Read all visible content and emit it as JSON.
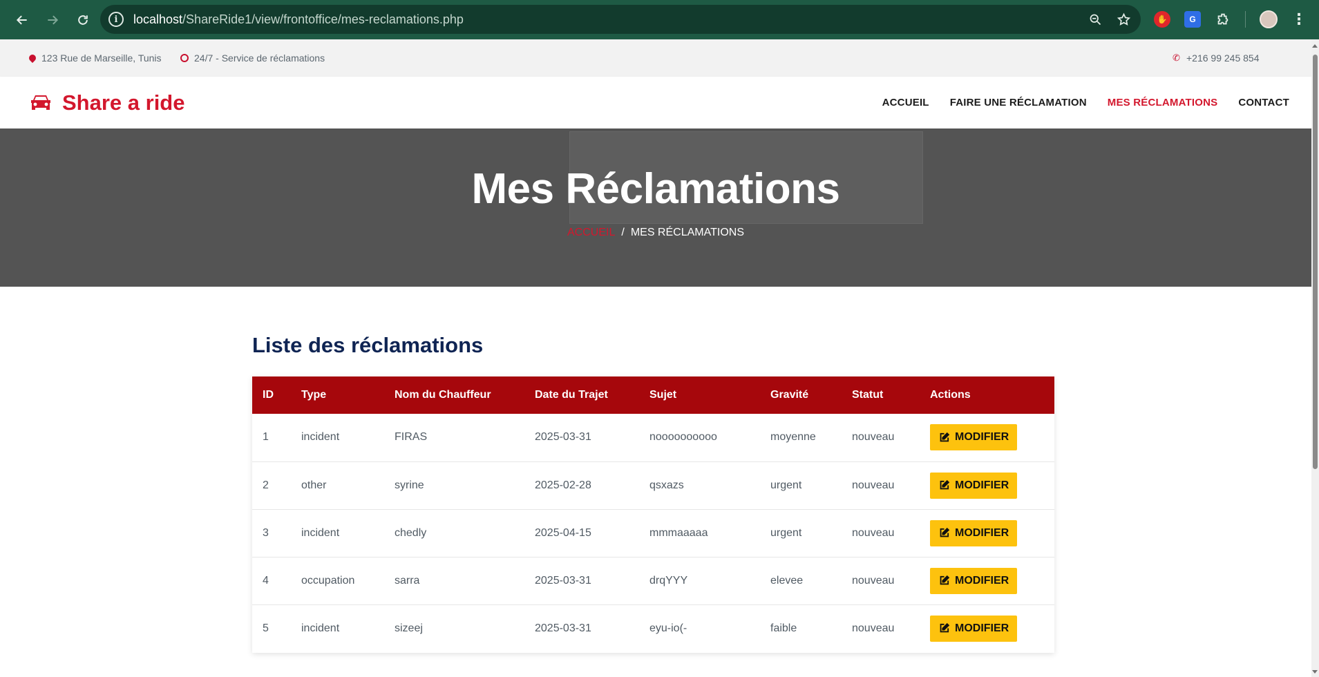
{
  "browser": {
    "url_host": "localhost",
    "url_path": "/ShareRide1/view/frontoffice/mes-reclamations.php"
  },
  "topbar": {
    "address": "123 Rue de Marseille, Tunis",
    "service": "24/7 - Service de réclamations",
    "phone": "+216 99 245 854"
  },
  "nav": {
    "brand": "Share a ride",
    "items": [
      {
        "label": "ACCUEIL"
      },
      {
        "label": "FAIRE UNE RÉCLAMATION"
      },
      {
        "label": "MES RÉCLAMATIONS"
      },
      {
        "label": "CONTACT"
      }
    ]
  },
  "hero": {
    "title": "Mes Réclamations",
    "crumb_home": "ACCUEIL",
    "crumb_sep": "/",
    "crumb_current": "MES RÉCLAMATIONS"
  },
  "section": {
    "title": "Liste des réclamations"
  },
  "table": {
    "headers": [
      "ID",
      "Type",
      "Nom du Chauffeur",
      "Date du Trajet",
      "Sujet",
      "Gravité",
      "Statut",
      "Actions"
    ],
    "action_label": "MODIFIER",
    "rows": [
      {
        "id": "1",
        "type": "incident",
        "driver": "FIRAS",
        "date": "2025-03-31",
        "subject": "noooooooooo",
        "severity": "moyenne",
        "status": "nouveau"
      },
      {
        "id": "2",
        "type": "other",
        "driver": "syrine",
        "date": "2025-02-28",
        "subject": "qsxazs",
        "severity": "urgent",
        "status": "nouveau"
      },
      {
        "id": "3",
        "type": "incident",
        "driver": "chedly",
        "date": "2025-04-15",
        "subject": "mmmaaaaa",
        "severity": "urgent",
        "status": "nouveau"
      },
      {
        "id": "4",
        "type": "occupation",
        "driver": "sarra",
        "date": "2025-03-31",
        "subject": "drqYYY",
        "severity": "elevee",
        "status": "nouveau"
      },
      {
        "id": "5",
        "type": "incident",
        "driver": "sizeej",
        "date": "2025-03-31",
        "subject": "eyu-io(-",
        "severity": "faible",
        "status": "nouveau"
      }
    ]
  },
  "colors": {
    "brand_red": "#d3172d",
    "table_header": "#a6070c",
    "button_yellow": "#fdc20e",
    "title_navy": "#0f2453"
  }
}
